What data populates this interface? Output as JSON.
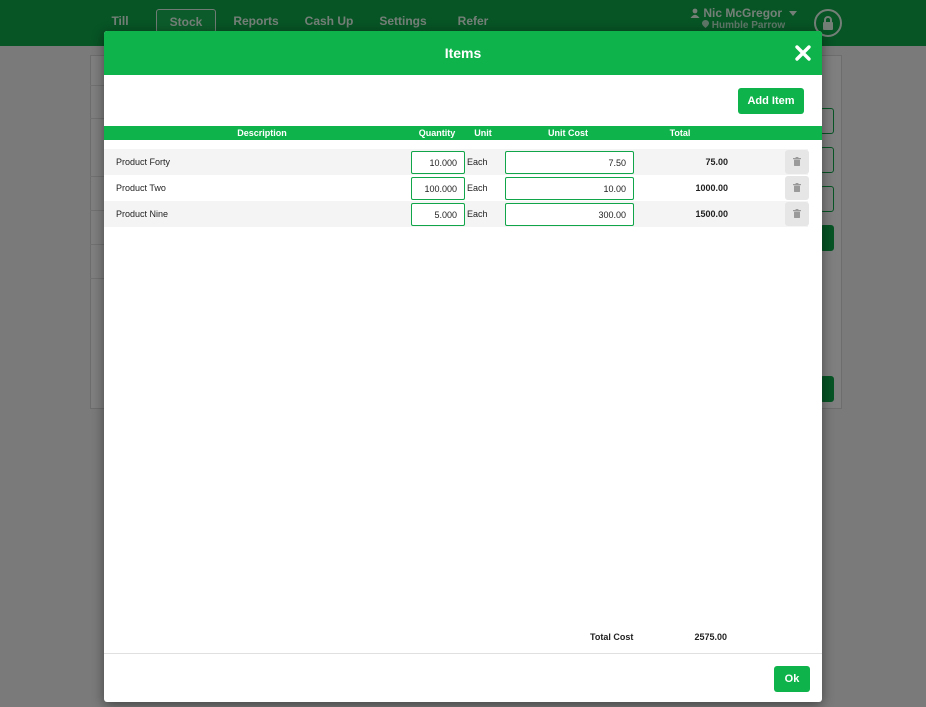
{
  "nav": {
    "tabs": [
      {
        "label": "Till"
      },
      {
        "label": "Stock"
      },
      {
        "label": "Reports"
      },
      {
        "label": "Cash Up"
      },
      {
        "label": "Settings"
      },
      {
        "label": "Refer"
      }
    ],
    "active_tab": "Stock",
    "user": {
      "name": "Nic McGregor",
      "shop": "Humble Parrow"
    },
    "icons": {
      "user": "user-icon",
      "caret": "caret-down-icon",
      "shop": "location-icon",
      "lock": "lock-icon"
    }
  },
  "modal": {
    "title": "Items",
    "close_icon": "close-icon",
    "add_label": "Add Item",
    "columns": {
      "description": "Description",
      "quantity": "Quantity",
      "unit": "Unit",
      "unit_cost": "Unit Cost",
      "total": "Total"
    },
    "rows": [
      {
        "description": "Product Forty",
        "quantity": "10.000",
        "unit": "Each",
        "unit_cost": "7.50",
        "total": "75.00"
      },
      {
        "description": "Product Two",
        "quantity": "100.000",
        "unit": "Each",
        "unit_cost": "10.00",
        "total": "1000.00"
      },
      {
        "description": "Product Nine",
        "quantity": "5.000",
        "unit": "Each",
        "unit_cost": "300.00",
        "total": "1500.00"
      }
    ],
    "delete_icon": "trash-icon",
    "total_cost_label": "Total Cost",
    "total_cost_value": "2575.00",
    "ok_label": "Ok"
  },
  "colors": {
    "accent": "#0fb34b",
    "overlay": "rgba(0,0,0,0.5)"
  }
}
